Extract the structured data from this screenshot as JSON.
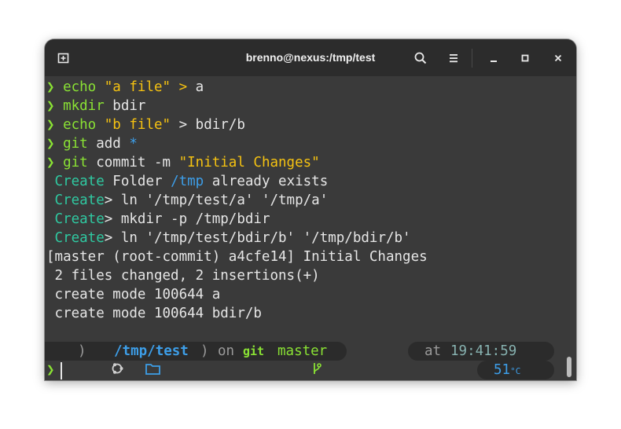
{
  "window": {
    "title": "brenno@nexus:/tmp/test"
  },
  "lines": [
    {
      "segments": [
        {
          "t": "❯ ",
          "c": "c-green"
        },
        {
          "t": "echo ",
          "c": "c-green"
        },
        {
          "t": "\"a file\"",
          "c": "c-yellow"
        },
        {
          "t": " > ",
          "c": "c-yellow"
        },
        {
          "t": "a",
          "c": "c-white"
        }
      ]
    },
    {
      "segments": [
        {
          "t": "❯ ",
          "c": "c-green"
        },
        {
          "t": "mkdir ",
          "c": "c-green"
        },
        {
          "t": "bdir",
          "c": "c-white"
        }
      ]
    },
    {
      "segments": [
        {
          "t": "❯ ",
          "c": "c-green"
        },
        {
          "t": "echo ",
          "c": "c-green"
        },
        {
          "t": "\"b file\"",
          "c": "c-yellow"
        },
        {
          "t": " > ",
          "c": "c-white"
        },
        {
          "t": "bdir/b",
          "c": "c-white"
        }
      ]
    },
    {
      "segments": [
        {
          "t": "❯ ",
          "c": "c-green"
        },
        {
          "t": "git ",
          "c": "c-green"
        },
        {
          "t": "add ",
          "c": "c-white"
        },
        {
          "t": "*",
          "c": "c-blue"
        }
      ]
    },
    {
      "segments": [
        {
          "t": "❯ ",
          "c": "c-green"
        },
        {
          "t": "git ",
          "c": "c-green"
        },
        {
          "t": "commit -m ",
          "c": "c-white"
        },
        {
          "t": "\"Initial Changes\"",
          "c": "c-yellow"
        }
      ]
    },
    {
      "segments": [
        {
          "t": " Create",
          "c": "c-cyan"
        },
        {
          "t": " Folder ",
          "c": "c-white"
        },
        {
          "t": "/tmp",
          "c": "c-blue"
        },
        {
          "t": " already exists",
          "c": "c-white"
        }
      ]
    },
    {
      "segments": [
        {
          "t": " Create",
          "c": "c-cyan"
        },
        {
          "t": "> ln '/tmp/test/a' '/tmp/a'",
          "c": "c-white"
        }
      ]
    },
    {
      "segments": [
        {
          "t": " Create",
          "c": "c-cyan"
        },
        {
          "t": "> mkdir -p /tmp/bdir",
          "c": "c-white"
        }
      ]
    },
    {
      "segments": [
        {
          "t": " Create",
          "c": "c-cyan"
        },
        {
          "t": "> ln '/tmp/test/bdir/b' '/tmp/bdir/b'",
          "c": "c-white"
        }
      ]
    },
    {
      "segments": [
        {
          "t": "[master (root-commit) a4cfe14] Initial Changes",
          "c": "c-white"
        }
      ]
    },
    {
      "segments": [
        {
          "t": " 2 files changed, 2 insertions(+)",
          "c": "c-white"
        }
      ]
    },
    {
      "segments": [
        {
          "t": " create mode 100644 a",
          "c": "c-white"
        }
      ]
    },
    {
      "segments": [
        {
          "t": " create mode 100644 bdir/b",
          "c": "c-white"
        }
      ]
    }
  ],
  "prompt": {
    "path_prefix": "/",
    "path_dir1": "tmp",
    "path_sep": "/",
    "path_dir2": "test",
    "on_label": "on",
    "git_label": "git",
    "branch": "master",
    "at_label": "at",
    "time": "19:41:59",
    "temp_value": "51",
    "temp_unit": "°C",
    "arrow": "❯"
  },
  "colors": {
    "title_bg": "#2c2c2c",
    "term_bg": "#3a3a3a",
    "green": "#8ae234",
    "yellow": "#f5c211",
    "blue": "#3d9ee8",
    "cyan": "#2fc9a1",
    "teal_time": "#87b2b0"
  }
}
